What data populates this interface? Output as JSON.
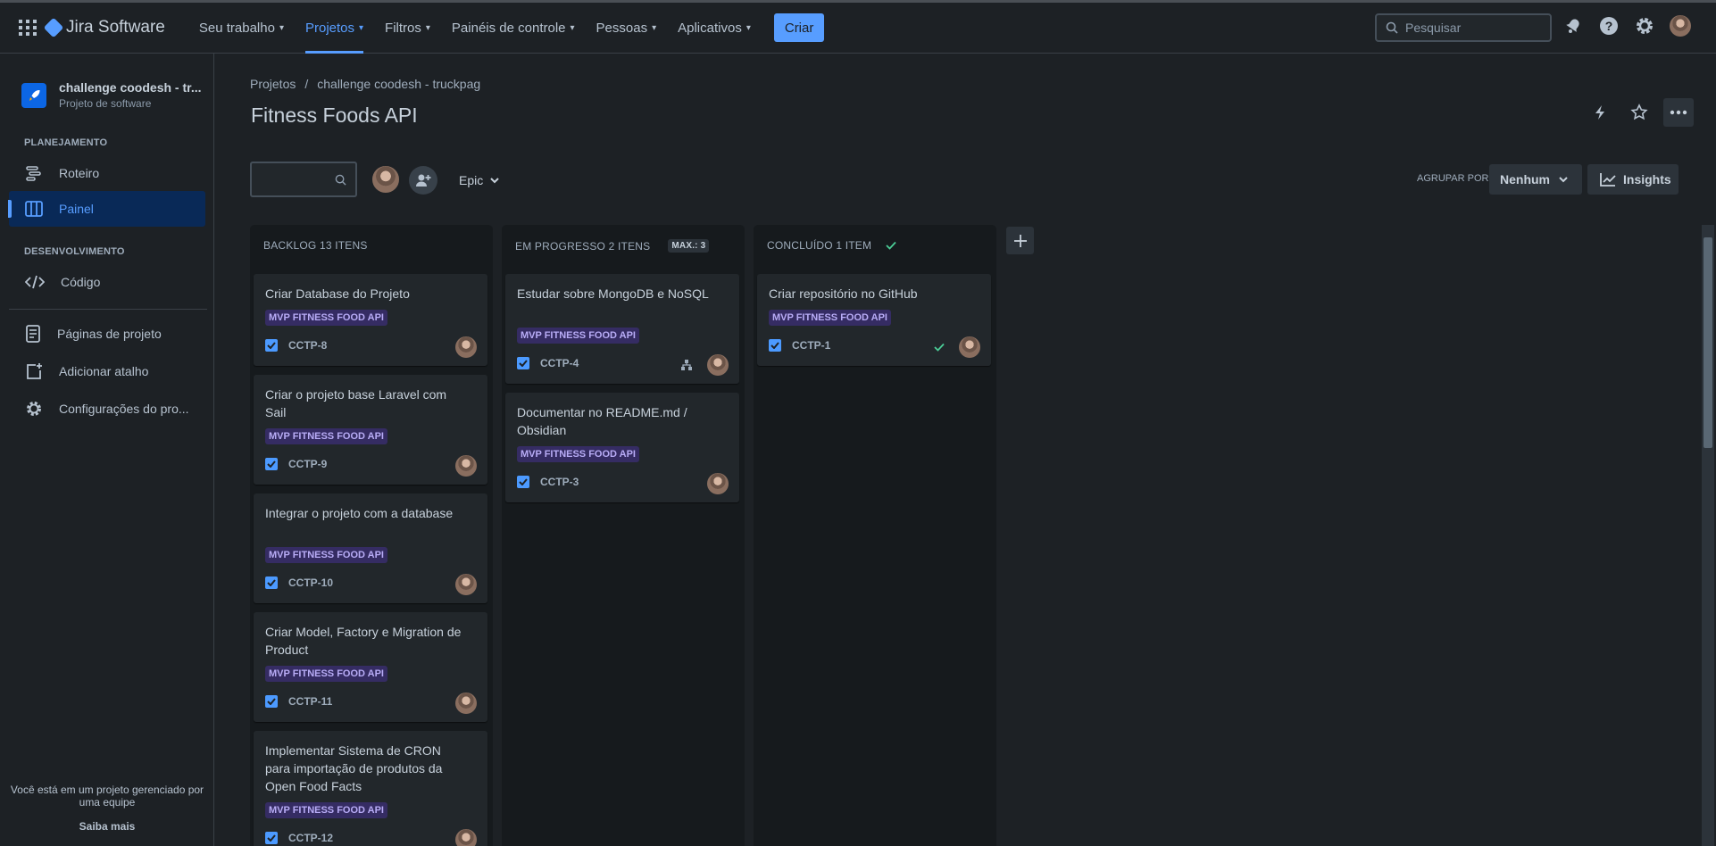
{
  "topnav": {
    "logo_text": "Jira Software",
    "items": [
      {
        "label": "Seu trabalho",
        "active": false
      },
      {
        "label": "Projetos",
        "active": true
      },
      {
        "label": "Filtros",
        "active": false
      },
      {
        "label": "Painéis de controle",
        "active": false
      },
      {
        "label": "Pessoas",
        "active": false
      },
      {
        "label": "Aplicativos",
        "active": false
      }
    ],
    "create_label": "Criar",
    "search_placeholder": "Pesquisar",
    "icons": [
      "notifications-icon",
      "help-icon",
      "settings-icon",
      "profile-avatar"
    ]
  },
  "sidebar": {
    "project_name": "challenge coodesh - tr...",
    "project_type": "Projeto de software",
    "sections": {
      "planning": "PLANEJAMENTO",
      "development": "DESENVOLVIMENTO"
    },
    "items": {
      "roadmap": "Roteiro",
      "board": "Painel",
      "code": "Código",
      "pages": "Páginas de projeto",
      "shortcut": "Adicionar atalho",
      "settings": "Configurações do pro..."
    },
    "footer_text": "Você está em um projeto gerenciado por uma equipe",
    "footer_link": "Saiba mais"
  },
  "header": {
    "breadcrumb": [
      "Projetos",
      "/",
      "challenge coodesh - truckpag"
    ],
    "title": "Fitness Foods API",
    "search_placeholder": ""
  },
  "toolbar": {
    "epic_label": "Epic",
    "group_by_label": "AGRUPAR POR",
    "group_by_value": "Nenhum",
    "insights_label": "Insights"
  },
  "colors": {
    "accent": "#579dff",
    "epic_bg": "#352c63",
    "epic_fg": "#b8acf6",
    "done_check": "#4bce97"
  },
  "columns": {
    "backlog": {
      "header": "BACKLOG 13 ITENS",
      "cards": [
        {
          "title": "Criar Database do Projeto",
          "epic": "MVP FITNESS FOOD API",
          "key": "CCTP-8"
        },
        {
          "title": "Criar o projeto base Laravel com Sail",
          "epic": "MVP FITNESS FOOD API",
          "key": "CCTP-9"
        },
        {
          "title": "Integrar o projeto com a database",
          "epic": "MVP FITNESS FOOD API",
          "key": "CCTP-10"
        },
        {
          "title": "Criar Model, Factory e Migration de Product",
          "epic": "MVP FITNESS FOOD API",
          "key": "CCTP-11"
        },
        {
          "title": "Implementar Sistema de CRON para importação de produtos da Open Food Facts",
          "epic": "MVP FITNESS FOOD API",
          "key": "CCTP-12"
        }
      ]
    },
    "progress": {
      "header": "EM PROGRESSO 2 ITENS",
      "max": "MAX.: 3",
      "cards": [
        {
          "title": "Estudar sobre MongoDB e NoSQL",
          "epic": "MVP FITNESS FOOD API",
          "key": "CCTP-4"
        },
        {
          "title": "Documentar no README.md / Obsidian",
          "epic": "MVP FITNESS FOOD API",
          "key": "CCTP-3"
        }
      ]
    },
    "done": {
      "header": "CONCLUÍDO 1 ITEM",
      "cards": [
        {
          "title": "Criar repositório no GitHub",
          "epic": "MVP FITNESS FOOD API",
          "key": "CCTP-1"
        }
      ]
    }
  }
}
